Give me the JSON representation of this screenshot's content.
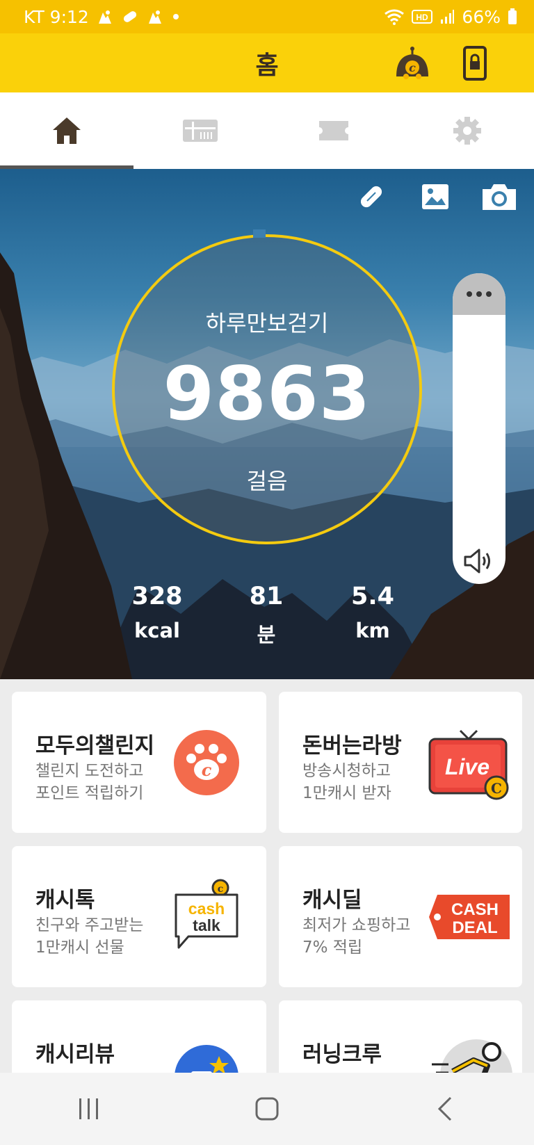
{
  "status_bar": {
    "carrier_time": "KT 9:12",
    "battery": "66%"
  },
  "header": {
    "title": "홈"
  },
  "tabs": [
    "home",
    "gift-card",
    "ticket",
    "settings"
  ],
  "hero": {
    "activity_title": "하루만보걷기",
    "steps": "9863",
    "steps_unit": "걸음",
    "stats": [
      {
        "value": "328",
        "unit": "kcal"
      },
      {
        "value": "81",
        "unit": "분"
      },
      {
        "value": "5.4",
        "unit": "km"
      }
    ]
  },
  "cards": [
    {
      "title": "모두의챌린지",
      "sub1": "챌린지 도전하고",
      "sub2": "포인트 적립하기"
    },
    {
      "title": "돈버는라방",
      "sub1": "방송시청하고",
      "sub2": "1만캐시 받자",
      "badge": "Live"
    },
    {
      "title": "캐시톡",
      "sub1": "친구와 주고받는",
      "sub2": "1만캐시 선물",
      "badge1": "cash",
      "badge2": "talk"
    },
    {
      "title": "캐시딜",
      "sub1": "최저가 쇼핑하고",
      "sub2": "7% 적립",
      "badge1": "CASH",
      "badge2": "DEAL"
    },
    {
      "title": "캐시리뷰",
      "sub1": "",
      "sub2": ""
    },
    {
      "title": "러닝크루",
      "sub1": "",
      "sub2": ""
    }
  ],
  "colors": {
    "brand_yellow": "#fad10a",
    "ring": "#f4cb10",
    "coral": "#f36b4c",
    "deal_red": "#e84a2b"
  }
}
